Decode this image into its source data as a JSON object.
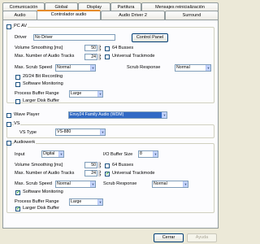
{
  "tabs_row1": [
    "Comunicación",
    "Global",
    "Display",
    "Partitura",
    "Mensajes reinicialización"
  ],
  "tabs_row2": [
    "Audio",
    "Controlador audio",
    "Audio Driver 2",
    "Surround"
  ],
  "pcav": {
    "label": "PC AV",
    "driver_label": "Driver",
    "driver_value": "No Driver",
    "control_panel": "Control Panel",
    "volume_label": "Volume Smoothing [ms]",
    "volume_value": "50",
    "busses": "64 Busses",
    "tracks_label": "Max. Number of Audio Tracks",
    "tracks_value": "24",
    "universal": "Universal Trackmode",
    "scrub_speed_label": "Max. Scrub Speed",
    "scrub_speed_value": "Normal",
    "scrub_response_label": "Scrub Response",
    "scrub_response_value": "Normal",
    "bit24": "20/24 Bit Recording",
    "software_monitoring": "Software Monitoring",
    "buffer_range_label": "Process Buffer Range",
    "buffer_range_value": "Large",
    "larger_disk": "Larger Disk Buffer"
  },
  "wave": {
    "label": "Wave Player",
    "value": "Envy24 Family Audio (WDM)"
  },
  "vs": {
    "label": "VS",
    "type_label": "VS Type",
    "type_value": "VS-880"
  },
  "audiowerk": {
    "label": "Audiowerk",
    "input_label": "Input",
    "input_value": "Digital",
    "io_buffer_label": "I/O Buffer Size",
    "io_buffer_value": "8",
    "volume_label": "Volume Smoothing [ms]",
    "volume_value": "50",
    "busses": "64 Busses",
    "tracks_label": "Max. Number of Audio Tracks",
    "tracks_value": "24",
    "universal": "Universal Trackmode",
    "scrub_speed_label": "Max. Scrub Speed",
    "scrub_speed_value": "Normal",
    "scrub_response_label": "Scrub Response",
    "scrub_response_value": "Normal",
    "software_monitoring": "Software Monitoring",
    "buffer_range_label": "Process Buffer Range",
    "buffer_range_value": "Large",
    "larger_disk": "Larger Disk Buffer"
  },
  "buttons": {
    "close": "Cerrar",
    "help": "Ayuda"
  },
  "colors": {
    "accent": "#e68b2c",
    "highlight": "#316ac5",
    "check": "#21a121"
  }
}
